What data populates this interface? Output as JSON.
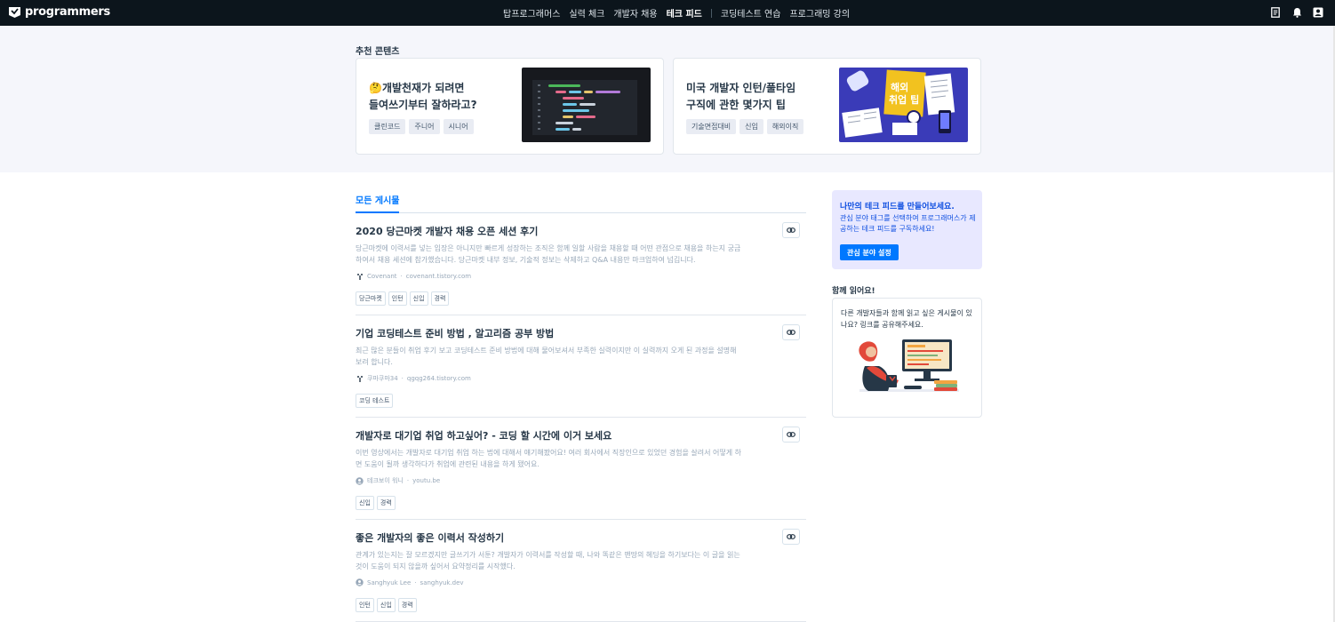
{
  "header": {
    "logo_text": "programmers",
    "nav": [
      {
        "label": "탑프로그래머스",
        "active": false
      },
      {
        "label": "실력 체크",
        "active": false
      },
      {
        "label": "개발자 채용",
        "active": false
      },
      {
        "label": "테크 피드",
        "active": true
      },
      {
        "label": "코딩테스트 연습",
        "active": false
      },
      {
        "label": "프로그래밍 강의",
        "active": false
      }
    ],
    "icons": [
      "document-icon",
      "bell-icon",
      "user-icon"
    ]
  },
  "recommended": {
    "title": "추천 콘텐츠",
    "cards": [
      {
        "title": "🤔개발천재가 되려면\n들여쓰기부터 잘하라고?",
        "tags": [
          "클린코드",
          "주니어",
          "시니어"
        ]
      },
      {
        "title": "미국 개발자 인턴/풀타임\n구직에 관한 몇가지 팁",
        "tags": [
          "기술면접대비",
          "신입",
          "해외이직"
        ],
        "thumb_text": "해외\n취업 팁"
      }
    ]
  },
  "feed": {
    "tab": "모든 게시물",
    "posts": [
      {
        "title": "2020 당근마켓 개발자 채용 오픈 세션 후기",
        "desc": "당근마켓에 이력서를 넣는 입장은 아니지만 빠르게 성장하는 조직은 함께 일할 사람을 채용할 때 어떤 관점으로 채용을 하는지 궁금하여서 채용 세션에 참가했습니다. 당근마켓 내부 정보, 기술적 정보는 삭제하고 Q&A 내용만 마크업하여 넘깁니다.",
        "author": "Covenant",
        "source": "covenant.tistory.com",
        "tags": [
          "당근마켓",
          "인턴",
          "신입",
          "경력"
        ]
      },
      {
        "title": "기업 코딩테스트 준비 방법 , 알고리즘 공부 방법",
        "desc": "최근 많은 분들이 취업 후기 보고 코딩테스트 준비 방법에 대해 물어보셔서 부족한 실력이지만 이 실력까지 오게 된 과정을 설명해 보려 합니다.",
        "author": "쿠마쿠마34",
        "source": "qgqg264.tistory.com",
        "tags": [
          "코딩 테스트"
        ]
      },
      {
        "title": "개발자로 대기업 취업 하고싶어? - 코딩 할 시간에 이거 보세요",
        "desc": "이번 영상에서는 개발자로 대기업 취업 하는 법에 대해서 얘기해봤어요! 여러 회사에서 직장인으로 있었던 경험을 살려서 어떻게 하면 도움이 될까 생각하다가 취업에 관련된 내용을 하게 됐어요.",
        "author": "테크보이 워니",
        "source": "youtu.be",
        "tags": [
          "신입",
          "경력"
        ]
      },
      {
        "title": "좋은 개발자의 좋은 이력서 작성하기",
        "desc": "관계가 있는지는 잘 모르겠지만 글쓰기가 서툰? 개발자가 이력서를 작성할 때, 나와 똑같은 맨땅의 헤딩을 하기보다는 이 글을 읽는 것이 도움이 되지 않을까 싶어서 요약정리를 시작했다.",
        "author": "Sanghyuk Lee",
        "source": "sanghyuk.dev",
        "tags": [
          "인턴",
          "신입",
          "경력"
        ]
      }
    ]
  },
  "sidebar": {
    "promo_title": "나만의 테크 피드를 만들어보세요.",
    "promo_desc": "관심 분야 태그를 선택하여 프로그래머스가 제공하는 테크 피드를 구독하세요!",
    "promo_button": "관심 분야 설정",
    "read_title": "함께 읽어요!",
    "read_desc": "다른 개발자들과 함께 읽고 싶은 게시물이 있나요? 링크를 공유해주세요."
  },
  "colors": {
    "accent": "#0078ff",
    "header_bg": "#0c151c",
    "band_bg": "#f5f6fb",
    "promo_bg": "#e8e8ff"
  }
}
